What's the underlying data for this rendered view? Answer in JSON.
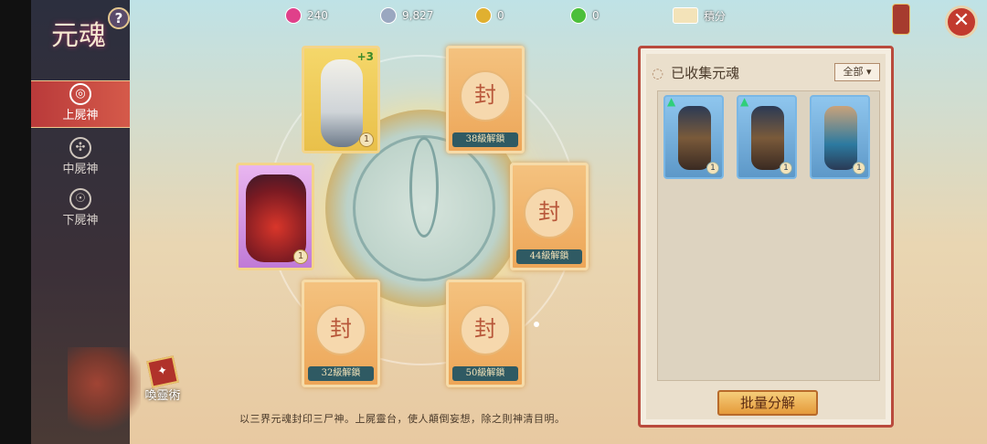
{
  "sidebar": {
    "title": "元魂",
    "help": "?",
    "items": [
      {
        "label": "上屍神",
        "badge": "之"
      },
      {
        "label": "中屍神"
      },
      {
        "label": "下屍神"
      }
    ],
    "summon": {
      "label": "喚靈術"
    }
  },
  "resources": [
    {
      "value": "240",
      "color": "#e0408a"
    },
    {
      "value": "9,827",
      "color": "#9aa7c0"
    },
    {
      "value": "0",
      "color": "#e0b030"
    },
    {
      "value": "0",
      "color": "#4cbf3a"
    }
  ],
  "points": {
    "label": "積分"
  },
  "close_icon": "✕",
  "slots": [
    {
      "seal": "封",
      "lock": "38級解鎖"
    },
    {
      "seal": "封",
      "lock": "44級解鎖"
    },
    {
      "seal": "封",
      "lock": "32級解鎖"
    },
    {
      "seal": "封",
      "lock": "50級解鎖"
    }
  ],
  "equipped": [
    {
      "plus": "+3",
      "level": "1"
    },
    {
      "level": "1"
    }
  ],
  "panel": {
    "title": "已收集元魂",
    "filter": "全部",
    "cards": [
      {
        "level": "1",
        "gem": true
      },
      {
        "level": "1",
        "gem": true
      },
      {
        "level": "1",
        "gem": false
      }
    ],
    "decompose": "批量分解"
  },
  "description": "以三界元魂封印三尸神。上屍靈台，使人顛倒妄想，除之則神清目明。"
}
